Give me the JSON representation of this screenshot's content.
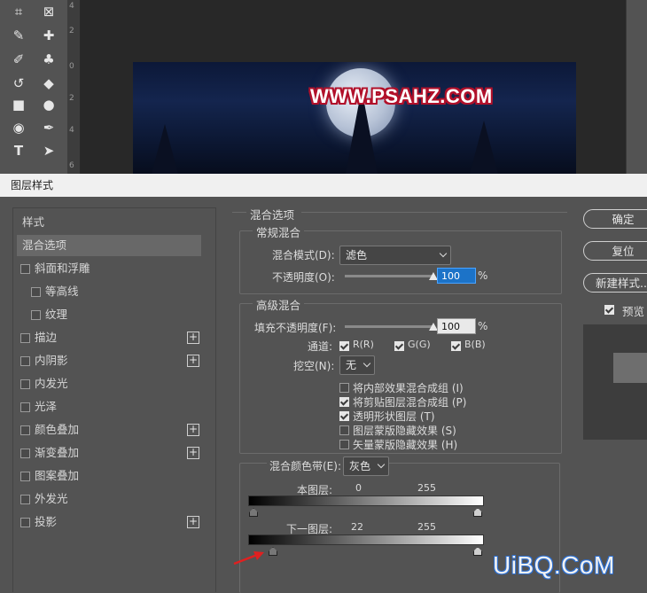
{
  "ruler": {
    "marks": [
      "4",
      "2",
      "0",
      "2",
      "4",
      "6"
    ]
  },
  "toolbar": {
    "icons": [
      "crop-icon",
      "frame-icon",
      "eyedropper-icon",
      "healing-brush-icon",
      "brush-icon",
      "stamp-icon",
      "history-brush-icon",
      "eraser-icon",
      "gradient-icon",
      "blur-icon",
      "dodge-icon",
      "pen-icon",
      "type-icon",
      "path-select-icon"
    ]
  },
  "document": {
    "watermark": "WWW.PSAHZ.COM"
  },
  "dialog": {
    "title": "图层样式"
  },
  "styles": {
    "header": "样式",
    "items": [
      {
        "label": "混合选项",
        "checkbox": false,
        "plus": false,
        "selected": true,
        "indent": false
      },
      {
        "label": "斜面和浮雕",
        "checkbox": true,
        "plus": false,
        "selected": false,
        "indent": false
      },
      {
        "label": "等高线",
        "checkbox": true,
        "plus": false,
        "selected": false,
        "indent": true
      },
      {
        "label": "纹理",
        "checkbox": true,
        "plus": false,
        "selected": false,
        "indent": true
      },
      {
        "label": "描边",
        "checkbox": true,
        "plus": true,
        "selected": false,
        "indent": false
      },
      {
        "label": "内阴影",
        "checkbox": true,
        "plus": true,
        "selected": false,
        "indent": false
      },
      {
        "label": "内发光",
        "checkbox": true,
        "plus": false,
        "selected": false,
        "indent": false
      },
      {
        "label": "光泽",
        "checkbox": true,
        "plus": false,
        "selected": false,
        "indent": false
      },
      {
        "label": "颜色叠加",
        "checkbox": true,
        "plus": true,
        "selected": false,
        "indent": false
      },
      {
        "label": "渐变叠加",
        "checkbox": true,
        "plus": true,
        "selected": false,
        "indent": false
      },
      {
        "label": "图案叠加",
        "checkbox": true,
        "plus": false,
        "selected": false,
        "indent": false
      },
      {
        "label": "外发光",
        "checkbox": true,
        "plus": false,
        "selected": false,
        "indent": false
      },
      {
        "label": "投影",
        "checkbox": true,
        "plus": true,
        "selected": false,
        "indent": false
      }
    ]
  },
  "blending": {
    "section_title": "混合选项",
    "general": {
      "title": "常规混合",
      "mode_label": "混合模式(D):",
      "mode_value": "滤色",
      "opacity_label": "不透明度(O):",
      "opacity_value": "100",
      "opacity_fraction": 1.0,
      "percent": "%"
    },
    "advanced": {
      "title": "高级混合",
      "fill_label": "填充不透明度(F):",
      "fill_value": "100",
      "fill_fraction": 1.0,
      "percent": "%",
      "channels_label": "通道:",
      "channel_r": "R(R)",
      "channel_g": "G(G)",
      "channel_b": "B(B)",
      "knockout_label": "挖空(N):",
      "knockout_value": "无",
      "options": [
        {
          "label": "将内部效果混合成组 (I)",
          "checked": false
        },
        {
          "label": "将剪贴图层混合成组 (P)",
          "checked": true
        },
        {
          "label": "透明形状图层 (T)",
          "checked": true
        },
        {
          "label": "图层蒙版隐藏效果 (S)",
          "checked": false
        },
        {
          "label": "矢量蒙版隐藏效果 (H)",
          "checked": false
        }
      ]
    },
    "blend_if": {
      "label": "混合颜色带(E):",
      "value": "灰色",
      "this_layer_label": "本图层:",
      "this_layer_low": "0",
      "this_layer_high": "255",
      "underlying_label": "下一图层:",
      "underlying_low": "22",
      "underlying_high": "255"
    }
  },
  "buttons": {
    "ok": "确定",
    "reset": "复位",
    "new_style": "新建样式...",
    "preview_label": "预览"
  },
  "watermark_bottom": "UiBQ.CoM"
}
